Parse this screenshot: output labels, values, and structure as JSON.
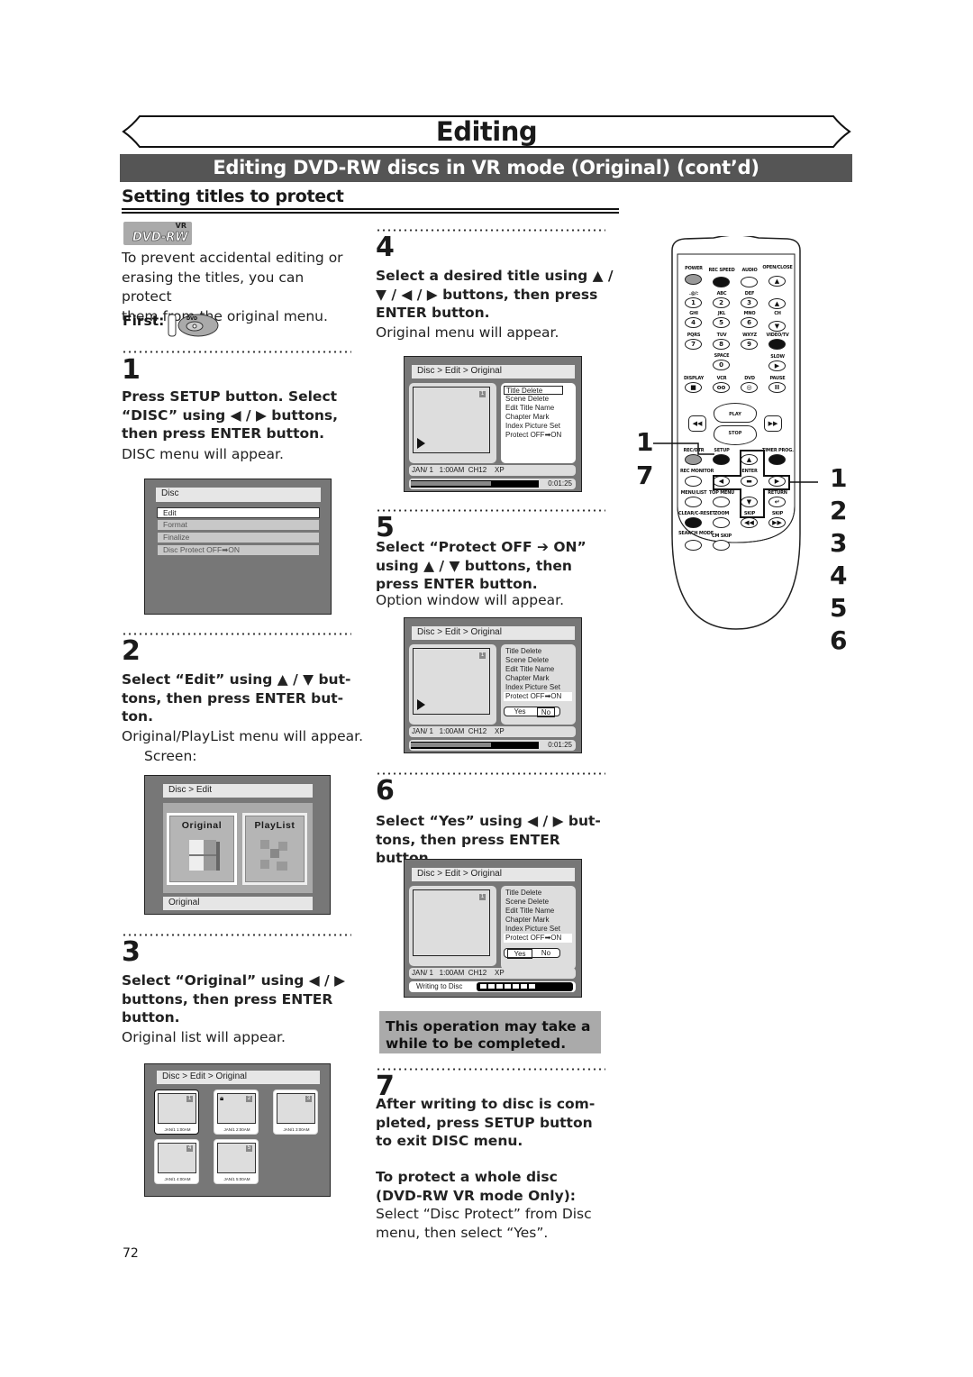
{
  "header": {
    "title": "Editing",
    "subtitle": "Editing DVD-RW discs in VR mode (Original) (cont’d)",
    "section": "Setting titles to protect"
  },
  "intro": {
    "logo_vr": "VR",
    "logo_text": "DVD-RW",
    "lines": [
      "To prevent accidental editing or",
      "erasing the titles, you can protect",
      "them from the original menu."
    ],
    "first_label": "First:",
    "first_icon_text": "DVD"
  },
  "steps": [
    {
      "num": "1",
      "bold": [
        "Press SETUP button. Select",
        "“DISC” using ◀ / ▶ buttons,",
        "then press ENTER button."
      ],
      "normal": [
        "DISC menu will appear."
      ],
      "screen": {
        "title": "Disc",
        "items": [
          "Edit",
          "Format",
          "Finalize",
          "Disc Protect OFF➡ON"
        ],
        "selected": 0
      }
    },
    {
      "num": "2",
      "bold": [
        "Select “Edit” using ▲ / ▼ but-",
        "tons, then press ENTER but-",
        "ton."
      ],
      "normal": [
        "Original/PlayList menu will appear.",
        "Screen:"
      ],
      "screen": {
        "title": "Disc > Edit",
        "options": [
          "Original",
          "PlayList"
        ],
        "footer": "Original"
      }
    },
    {
      "num": "3",
      "bold": [
        "Select “Original” using ◀ / ▶",
        "buttons, then press ENTER",
        "button."
      ],
      "normal": [
        "Original list will appear."
      ],
      "screen": {
        "title": "Disc > Edit > Original",
        "titles": [
          {
            "n": "1",
            "date": "JAN/1",
            "time": "1:00AM",
            "locked": false
          },
          {
            "n": "2",
            "date": "JAN/1",
            "time": "2:00AM",
            "locked": true
          },
          {
            "n": "3",
            "date": "JAN/1",
            "time": "3:00AM",
            "locked": false
          },
          {
            "n": "4",
            "date": "JAN/1",
            "time": "4:00AM",
            "locked": false
          },
          {
            "n": "5",
            "date": "JAN/1",
            "time": "5:00AM",
            "locked": false
          }
        ]
      }
    },
    {
      "num": "4",
      "bold": [
        "Select a desired title using ▲ /",
        "▼ / ◀ / ▶ buttons, then press",
        "ENTER button."
      ],
      "normal": [
        "Original menu will appear."
      ],
      "screen": {
        "title": "Disc > Edit > Original",
        "thumb_num": "1",
        "menu": [
          "Title Delete",
          "Scene Delete",
          "Edit Title Name",
          "Chapter Mark",
          "Index Picture Set",
          "Protect OFF➡ON"
        ],
        "info": "JAN/ 1   1:00AM  CH12    XP",
        "time": "0:01:25",
        "progress": 0.63
      }
    },
    {
      "num": "5",
      "bold": [
        "Select “Protect OFF ➔ ON”",
        "using ▲ / ▼ buttons, then",
        "press ENTER button."
      ],
      "normal": [
        "Option window will appear."
      ],
      "screen": {
        "title": "Disc > Edit > Original",
        "thumb_num": "1",
        "menu": [
          "Title Delete",
          "Scene Delete",
          "Edit Title Name",
          "Chapter Mark",
          "Index Picture Set",
          "Protect OFF➡ON"
        ],
        "yes": "Yes",
        "no": "No",
        "info": "JAN/ 1   1:00AM  CH12    XP",
        "time": "0:01:25",
        "progress": 0.63
      }
    },
    {
      "num": "6",
      "bold": [
        "Select “Yes” using ◀ / ▶ but-",
        "tons, then press ENTER button."
      ],
      "normal": [],
      "screen": {
        "title": "Disc > Edit > Original",
        "thumb_num": "1",
        "menu": [
          "Title Delete",
          "Scene Delete",
          "Edit Title Name",
          "Chapter Mark",
          "Index Picture Set",
          "Protect OFF➡ON"
        ],
        "yes": "Yes",
        "no": "No",
        "info": "JAN/ 1   1:00AM  CH12    XP",
        "writing": "Writing to Disc",
        "blocks": 7
      }
    },
    {
      "num": "7",
      "bold": [
        "After writing to disc is com-",
        "pleted, press SETUP button",
        "to exit DISC menu."
      ],
      "normal": []
    }
  ],
  "note": [
    "This operation may take a",
    "while to be completed."
  ],
  "whole_disc": {
    "bold": [
      "To protect a whole disc",
      "(DVD-RW VR mode Only):"
    ],
    "normal": [
      "Select “Disc Protect” from Disc",
      "menu, then select “Yes”."
    ]
  },
  "remote": {
    "labels": {
      "power": "POWER",
      "rec_speed": "REC SPEED",
      "audio": "AUDIO",
      "open_close": "OPEN/CLOSE",
      "k1": ".@/:",
      "k2": "ABC",
      "k3": "DEF",
      "k4": "GHI",
      "k5": "JKL",
      "k6": "MNO",
      "k7": "PQRS",
      "k8": "TUV",
      "k9": "WXYZ",
      "video_tv": "VIDEO/TV",
      "space": "SPACE",
      "slow": "SLOW",
      "ch": "CH",
      "display": "DISPLAY",
      "vcr": "VCR",
      "dvd": "DVD",
      "pause": "PAUSE",
      "play": "PLAY",
      "stop": "STOP",
      "rec_otr": "REC/OTR",
      "setup": "SETUP",
      "timer_prog": "TIMER PROG.",
      "rec_monitor": "REC MONITOR",
      "enter": "ENTER",
      "menu_list": "MENU/LIST",
      "top_menu": "TOP MENU",
      "return": "RETURN",
      "clear_reset": "CLEAR/C-RESET",
      "zoom": "ZOOM",
      "skip_back": "SKIP",
      "skip_fwd": "SKIP",
      "search_mode": "SEARCH MODE",
      "cm_skip": "CM SKIP"
    },
    "digits": [
      "1",
      "2",
      "3",
      "4",
      "5",
      "6",
      "7",
      "8",
      "9",
      "0"
    ],
    "callouts_left": [
      "1",
      "7"
    ],
    "callouts_right": [
      "1",
      "2",
      "3",
      "4",
      "5",
      "6"
    ]
  },
  "page_number": "72"
}
